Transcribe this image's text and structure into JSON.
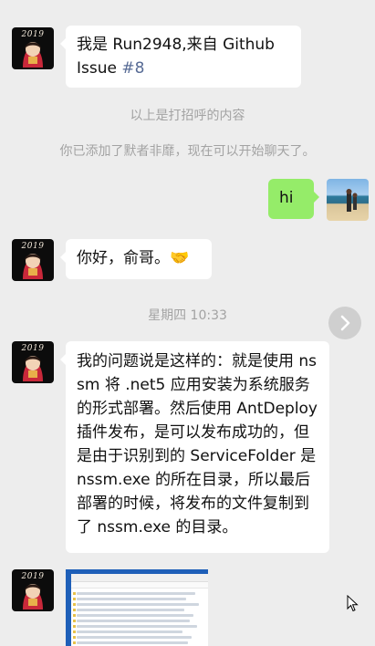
{
  "avatar": {
    "year": "2019"
  },
  "messages": {
    "m1_prefix": "我是 Run2948,来自 Github Issue ",
    "m1_link": "#8",
    "greeting_note": "以上是打招呼的内容",
    "added_note": "你已添加了默者非靡，现在可以开始聊天了。",
    "hi": "hi",
    "nihao": "你好，俞哥。",
    "handshake_emoji": "🤝",
    "timestamp": "星期四 10:33",
    "long": "我的问题说是这样的：就是使用 nssm 将 .net5 应用安装为系统服务的形式部署。然后使用 AntDeploy 插件发布，是可以发布成功的，但是由于识别到的 ServiceFolder 是 nssm.exe 的所在目录，所以最后部署的时候，将发布的文件复制到了 nssm.exe 的目录。"
  },
  "icons": {
    "avatar": "anime-avatar-icon",
    "photo": "beach-photo-thumbnail",
    "next": "chevron-right-icon",
    "cursor": "mouse-pointer-icon"
  },
  "colors": {
    "background": "#ededed",
    "bubble_left": "#ffffff",
    "bubble_right": "#95ec69",
    "link": "#576b95",
    "system_text": "#a3a3a3"
  }
}
